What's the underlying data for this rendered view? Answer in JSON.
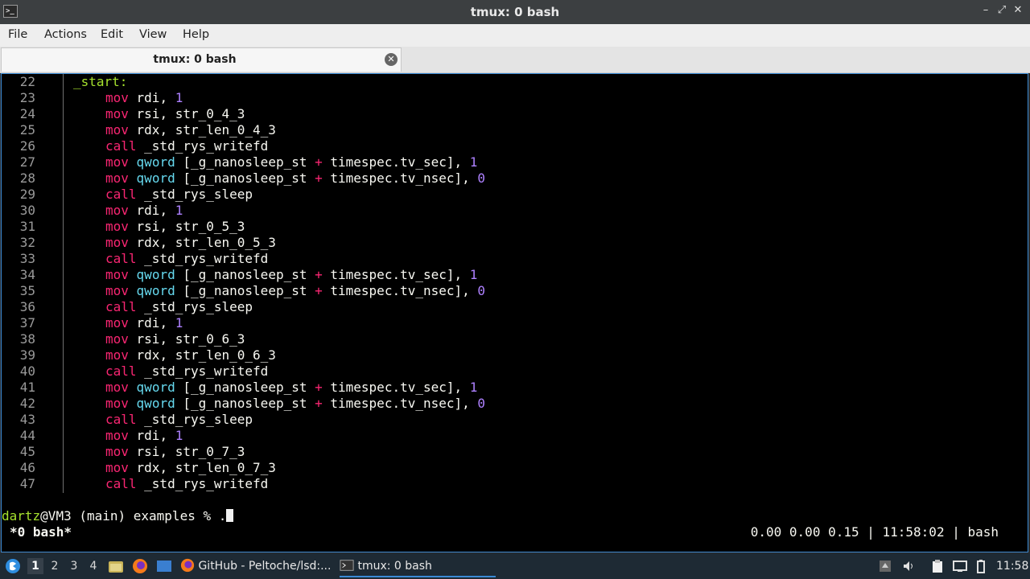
{
  "window": {
    "title": "tmux: 0 bash"
  },
  "menu": [
    "File",
    "Actions",
    "Edit",
    "View",
    "Help"
  ],
  "tab": {
    "label": "tmux: 0 bash"
  },
  "code": [
    {
      "n": "22",
      "indent": 1,
      "parts": [
        {
          "c": "lbl",
          "t": "_start:"
        }
      ]
    },
    {
      "n": "23",
      "indent": 2,
      "parts": [
        {
          "c": "kw",
          "t": "mov"
        },
        {
          "c": "",
          "t": " rdi, "
        },
        {
          "c": "num",
          "t": "1"
        }
      ]
    },
    {
      "n": "24",
      "indent": 2,
      "parts": [
        {
          "c": "kw",
          "t": "mov"
        },
        {
          "c": "",
          "t": " rsi, str_0_4_3"
        }
      ]
    },
    {
      "n": "25",
      "indent": 2,
      "parts": [
        {
          "c": "kw",
          "t": "mov"
        },
        {
          "c": "",
          "t": " rdx, str_len_0_4_3"
        }
      ]
    },
    {
      "n": "26",
      "indent": 2,
      "parts": [
        {
          "c": "kw",
          "t": "call"
        },
        {
          "c": "",
          "t": " _std_rys_writefd"
        }
      ]
    },
    {
      "n": "27",
      "indent": 2,
      "parts": [
        {
          "c": "kw",
          "t": "mov"
        },
        {
          "c": "",
          "t": " "
        },
        {
          "c": "ty",
          "t": "qword"
        },
        {
          "c": "",
          "t": " [_g_nanosleep_st "
        },
        {
          "c": "op",
          "t": "+"
        },
        {
          "c": "",
          "t": " timespec.tv_sec], "
        },
        {
          "c": "num",
          "t": "1"
        }
      ]
    },
    {
      "n": "28",
      "indent": 2,
      "parts": [
        {
          "c": "kw",
          "t": "mov"
        },
        {
          "c": "",
          "t": " "
        },
        {
          "c": "ty",
          "t": "qword"
        },
        {
          "c": "",
          "t": " [_g_nanosleep_st "
        },
        {
          "c": "op",
          "t": "+"
        },
        {
          "c": "",
          "t": " timespec.tv_nsec], "
        },
        {
          "c": "num",
          "t": "0"
        }
      ]
    },
    {
      "n": "29",
      "indent": 2,
      "parts": [
        {
          "c": "kw",
          "t": "call"
        },
        {
          "c": "",
          "t": " _std_rys_sleep"
        }
      ]
    },
    {
      "n": "30",
      "indent": 2,
      "parts": [
        {
          "c": "kw",
          "t": "mov"
        },
        {
          "c": "",
          "t": " rdi, "
        },
        {
          "c": "num",
          "t": "1"
        }
      ]
    },
    {
      "n": "31",
      "indent": 2,
      "parts": [
        {
          "c": "kw",
          "t": "mov"
        },
        {
          "c": "",
          "t": " rsi, str_0_5_3"
        }
      ]
    },
    {
      "n": "32",
      "indent": 2,
      "parts": [
        {
          "c": "kw",
          "t": "mov"
        },
        {
          "c": "",
          "t": " rdx, str_len_0_5_3"
        }
      ]
    },
    {
      "n": "33",
      "indent": 2,
      "parts": [
        {
          "c": "kw",
          "t": "call"
        },
        {
          "c": "",
          "t": " _std_rys_writefd"
        }
      ]
    },
    {
      "n": "34",
      "indent": 2,
      "parts": [
        {
          "c": "kw",
          "t": "mov"
        },
        {
          "c": "",
          "t": " "
        },
        {
          "c": "ty",
          "t": "qword"
        },
        {
          "c": "",
          "t": " [_g_nanosleep_st "
        },
        {
          "c": "op",
          "t": "+"
        },
        {
          "c": "",
          "t": " timespec.tv_sec], "
        },
        {
          "c": "num",
          "t": "1"
        }
      ]
    },
    {
      "n": "35",
      "indent": 2,
      "parts": [
        {
          "c": "kw",
          "t": "mov"
        },
        {
          "c": "",
          "t": " "
        },
        {
          "c": "ty",
          "t": "qword"
        },
        {
          "c": "",
          "t": " [_g_nanosleep_st "
        },
        {
          "c": "op",
          "t": "+"
        },
        {
          "c": "",
          "t": " timespec.tv_nsec], "
        },
        {
          "c": "num",
          "t": "0"
        }
      ]
    },
    {
      "n": "36",
      "indent": 2,
      "parts": [
        {
          "c": "kw",
          "t": "call"
        },
        {
          "c": "",
          "t": " _std_rys_sleep"
        }
      ]
    },
    {
      "n": "37",
      "indent": 2,
      "parts": [
        {
          "c": "kw",
          "t": "mov"
        },
        {
          "c": "",
          "t": " rdi, "
        },
        {
          "c": "num",
          "t": "1"
        }
      ]
    },
    {
      "n": "38",
      "indent": 2,
      "parts": [
        {
          "c": "kw",
          "t": "mov"
        },
        {
          "c": "",
          "t": " rsi, str_0_6_3"
        }
      ]
    },
    {
      "n": "39",
      "indent": 2,
      "parts": [
        {
          "c": "kw",
          "t": "mov"
        },
        {
          "c": "",
          "t": " rdx, str_len_0_6_3"
        }
      ]
    },
    {
      "n": "40",
      "indent": 2,
      "parts": [
        {
          "c": "kw",
          "t": "call"
        },
        {
          "c": "",
          "t": " _std_rys_writefd"
        }
      ]
    },
    {
      "n": "41",
      "indent": 2,
      "parts": [
        {
          "c": "kw",
          "t": "mov"
        },
        {
          "c": "",
          "t": " "
        },
        {
          "c": "ty",
          "t": "qword"
        },
        {
          "c": "",
          "t": " [_g_nanosleep_st "
        },
        {
          "c": "op",
          "t": "+"
        },
        {
          "c": "",
          "t": " timespec.tv_sec], "
        },
        {
          "c": "num",
          "t": "1"
        }
      ]
    },
    {
      "n": "42",
      "indent": 2,
      "parts": [
        {
          "c": "kw",
          "t": "mov"
        },
        {
          "c": "",
          "t": " "
        },
        {
          "c": "ty",
          "t": "qword"
        },
        {
          "c": "",
          "t": " [_g_nanosleep_st "
        },
        {
          "c": "op",
          "t": "+"
        },
        {
          "c": "",
          "t": " timespec.tv_nsec], "
        },
        {
          "c": "num",
          "t": "0"
        }
      ]
    },
    {
      "n": "43",
      "indent": 2,
      "parts": [
        {
          "c": "kw",
          "t": "call"
        },
        {
          "c": "",
          "t": " _std_rys_sleep"
        }
      ]
    },
    {
      "n": "44",
      "indent": 2,
      "parts": [
        {
          "c": "kw",
          "t": "mov"
        },
        {
          "c": "",
          "t": " rdi, "
        },
        {
          "c": "num",
          "t": "1"
        }
      ]
    },
    {
      "n": "45",
      "indent": 2,
      "parts": [
        {
          "c": "kw",
          "t": "mov"
        },
        {
          "c": "",
          "t": " rsi, str_0_7_3"
        }
      ]
    },
    {
      "n": "46",
      "indent": 2,
      "parts": [
        {
          "c": "kw",
          "t": "mov"
        },
        {
          "c": "",
          "t": " rdx, str_len_0_7_3"
        }
      ]
    },
    {
      "n": "47",
      "indent": 2,
      "parts": [
        {
          "c": "kw",
          "t": "call"
        },
        {
          "c": "",
          "t": " _std_rys_writefd"
        }
      ]
    }
  ],
  "prompt": {
    "user": "dartz",
    "rest": "@VM3 (main) examples % ",
    "typed": "."
  },
  "tmux_status": {
    "left": "*0 bash*",
    "right": "0.00 0.00 0.15 | 11:58:02 | bash"
  },
  "taskbar": {
    "workspaces": [
      "1",
      "2",
      "3",
      "4"
    ],
    "active_workspace": "1",
    "tasks": [
      {
        "label": "GitHub - Peltoche/lsd:...",
        "icon": "firefox-icon"
      },
      {
        "label": "tmux: 0 bash",
        "icon": "terminal-icon"
      }
    ],
    "clock": "11:58"
  },
  "colors": {
    "keyword": "#f92672",
    "type": "#66d9ef",
    "number": "#ae81ff",
    "label": "#a6e22e",
    "accent": "#3a8ad4"
  }
}
